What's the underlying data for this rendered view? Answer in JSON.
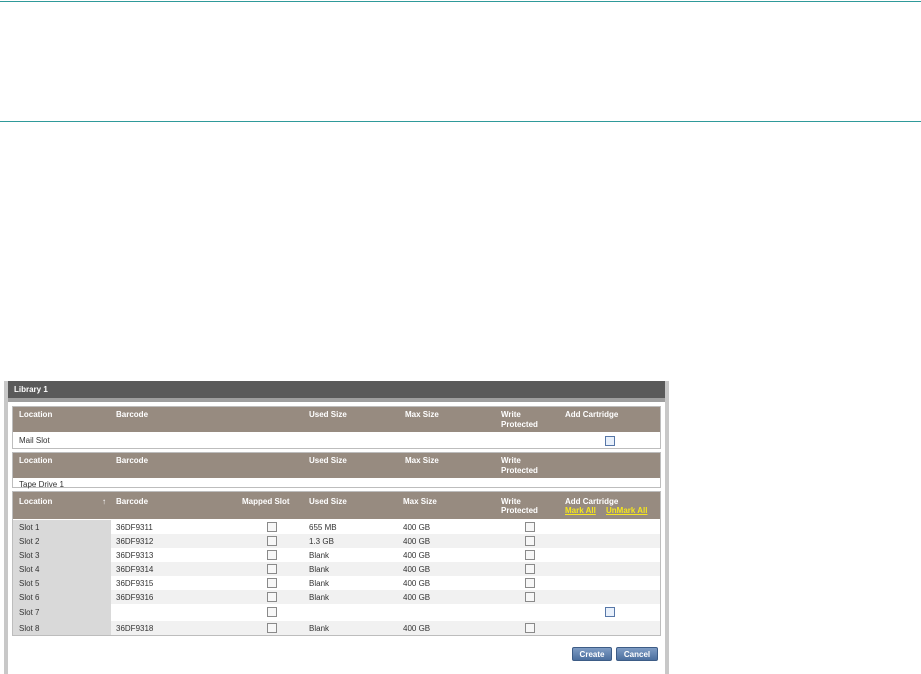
{
  "library_title": "Library 1",
  "mail_section": {
    "headers": {
      "location": "Location",
      "barcode": "Barcode",
      "used": "Used Size",
      "max": "Max Size",
      "wp1": "Write",
      "wp2": "Protected",
      "add": "Add Cartridge"
    },
    "row": {
      "location": "Mail Slot",
      "add_checked": false
    }
  },
  "drive_section": {
    "headers": {
      "location": "Location",
      "barcode": "Barcode",
      "used": "Used Size",
      "max": "Max Size",
      "wp1": "Write",
      "wp2": "Protected"
    },
    "row": {
      "location": "Tape Drive 1"
    }
  },
  "slot_section": {
    "headers": {
      "location": "Location",
      "sort_icon": "↑",
      "barcode": "Barcode",
      "mapped": "Mapped Slot",
      "used": "Used Size",
      "max": "Max Size",
      "wp1": "Write",
      "wp2": "Protected",
      "add": "Add Cartridge",
      "mark_all": "Mark All",
      "unmark_all": "UnMark All"
    },
    "rows": [
      {
        "location": "Slot 1",
        "barcode": "36DF9311",
        "used": "655 MB",
        "max": "400 GB"
      },
      {
        "location": "Slot 2",
        "barcode": "36DF9312",
        "used": "1.3 GB",
        "max": "400 GB"
      },
      {
        "location": "Slot 3",
        "barcode": "36DF9313",
        "used": "Blank",
        "max": "400 GB"
      },
      {
        "location": "Slot 4",
        "barcode": "36DF9314",
        "used": "Blank",
        "max": "400 GB"
      },
      {
        "location": "Slot 5",
        "barcode": "36DF9315",
        "used": "Blank",
        "max": "400 GB"
      },
      {
        "location": "Slot 6",
        "barcode": "36DF9316",
        "used": "Blank",
        "max": "400 GB"
      },
      {
        "location": "Slot 7",
        "barcode": "",
        "used": "",
        "max": ""
      },
      {
        "location": "Slot 8",
        "barcode": "36DF9318",
        "used": "Blank",
        "max": "400 GB"
      }
    ]
  },
  "buttons": {
    "create": "Create",
    "cancel": "Cancel"
  },
  "colors": {
    "accent_rule": "#2f9a9a",
    "header_bg": "#978b80",
    "title_bg": "#5a5a5a",
    "link": "#f5e61d",
    "button": "#5a7fb0"
  }
}
